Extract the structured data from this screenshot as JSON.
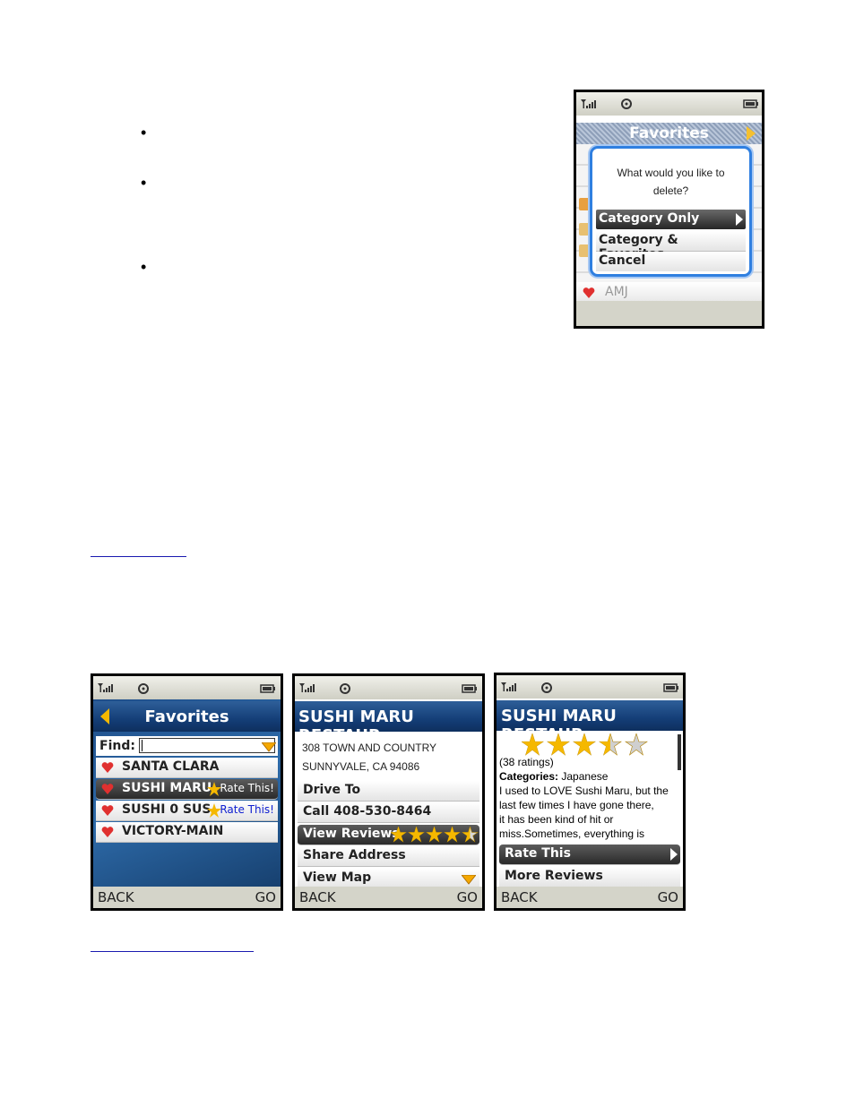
{
  "dialog_phone": {
    "title": "Favorites",
    "prompt_line1": "What would you like to",
    "prompt_line2": "delete?",
    "options": [
      "Category Only",
      "Category & Favorites",
      "Cancel"
    ],
    "bottom_item": "AMJ"
  },
  "favorites_phone": {
    "title": "Favorites",
    "find_label": "Find:",
    "items": [
      "SANTA CLARA",
      "SUSHI MARU",
      "SUSHI 0 SUS",
      "VICTORY-MAIN"
    ],
    "rate_label": "Rate This!",
    "soft_left": "BACK",
    "soft_right": "GO"
  },
  "details_phone": {
    "title": "SUSHI MARU RESTAUR",
    "address_line1": "308 TOWN AND COUNTRY",
    "address_line2": "SUNNYVALE, CA 94086",
    "menu": [
      "Drive To",
      "Call 408-530-8464",
      "View Reviews",
      "Share Address",
      "View Map"
    ],
    "rating": 4.5,
    "soft_left": "BACK",
    "soft_right": "GO"
  },
  "reviews_phone": {
    "title": "SUSHI MARU RESTAUR",
    "rating": 3.5,
    "ratings_count": "(38 ratings)",
    "categories_label": "Categories:",
    "categories_value": "Japanese",
    "review_lines": [
      "I used to LOVE Sushi Maru, but the",
      "last few times I have gone there,",
      "it has been kind of hit or",
      "miss.Sometimes, everything is"
    ],
    "menu": [
      "Rate This",
      "More Reviews"
    ],
    "soft_left": "BACK",
    "soft_right": "GO"
  },
  "colors": {
    "accent_blue": "#143e77",
    "dialog_border": "#2f7fe0",
    "star": "#f5b800",
    "heart": "#e0302f"
  }
}
